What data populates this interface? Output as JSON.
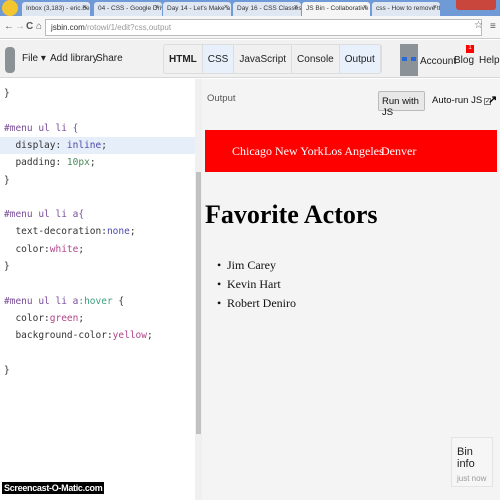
{
  "browser": {
    "tabs": [
      {
        "label": "Inbox (3,183) - eric.bemg",
        "active": false
      },
      {
        "label": "04 - CSS - Google Drive",
        "active": false
      },
      {
        "label": "Day 14 - Let's Make a Na",
        "active": false
      },
      {
        "label": "Day 16 - CSS Classes - Go",
        "active": false
      },
      {
        "label": "JS Bin - Collaborative Java",
        "active": true
      },
      {
        "label": "css - How to remove the",
        "active": false
      }
    ],
    "close_glyph": "×",
    "url_host": "jsbin.com",
    "url_path": "/rotowi/1/edit?css,output",
    "nav": {
      "back": "←",
      "forward": "→",
      "reload": "C",
      "home": "⌂",
      "star": "☆",
      "menu": "≡"
    }
  },
  "toolbar": {
    "file": "File ▾",
    "add_library": "Add library",
    "share": "Share",
    "panels": [
      {
        "label": "HTML",
        "active": false,
        "bold": true
      },
      {
        "label": "CSS",
        "active": true
      },
      {
        "label": "JavaScript",
        "active": false
      },
      {
        "label": "Console",
        "active": false
      },
      {
        "label": "Output",
        "active": true
      }
    ],
    "account": "Account",
    "blog": "Blog",
    "blog_badge": "1",
    "help": "Help"
  },
  "editor": {
    "lines": [
      [
        {
          "t": "}",
          "c": "prop"
        }
      ],
      [],
      [
        {
          "t": "#menu ul li {",
          "c": "sel"
        }
      ],
      [
        {
          "t": "  display: ",
          "c": "prop"
        },
        {
          "t": "inline",
          "c": "kw"
        },
        {
          "t": ";",
          "c": "prop"
        }
      ],
      [
        {
          "t": "  padding: ",
          "c": "prop"
        },
        {
          "t": "10px",
          "c": "num"
        },
        {
          "t": ";",
          "c": "prop"
        }
      ],
      [
        {
          "t": "}",
          "c": "prop"
        }
      ],
      [],
      [
        {
          "t": "#menu ul li a{",
          "c": "sel"
        }
      ],
      [
        {
          "t": "  text-decoration:",
          "c": "prop"
        },
        {
          "t": "none",
          "c": "kw"
        },
        {
          "t": ";",
          "c": "prop"
        }
      ],
      [
        {
          "t": "  color:",
          "c": "prop"
        },
        {
          "t": "white",
          "c": "col"
        },
        {
          "t": ";",
          "c": "prop"
        }
      ],
      [
        {
          "t": "}",
          "c": "prop"
        }
      ],
      [],
      [
        {
          "t": "#menu ul li a",
          "c": "sel"
        },
        {
          "t": ":hover",
          "c": "ps"
        },
        {
          "t": " {",
          "c": "prop"
        }
      ],
      [
        {
          "t": "  color:",
          "c": "prop"
        },
        {
          "t": "green",
          "c": "col"
        },
        {
          "t": ";",
          "c": "prop"
        }
      ],
      [
        {
          "t": "  background-color:",
          "c": "prop"
        },
        {
          "t": "yellow",
          "c": "col"
        },
        {
          "t": ";",
          "c": "prop"
        }
      ],
      [],
      [
        {
          "t": "}",
          "c": "prop"
        }
      ]
    ]
  },
  "output": {
    "label": "Output",
    "run_button": "Run with JS",
    "autorun_label": "Auto-run JS",
    "autorun_checked": true,
    "popout": "↗",
    "menu_links": [
      "Chicago",
      "New York",
      "Los Angeles",
      "Denver"
    ],
    "menu_bg": "#ff0000",
    "heading": "Favorite Actors",
    "list": [
      "Jim Carey",
      "Kevin Hart",
      "Robert Deniro"
    ]
  },
  "bin_info": {
    "title": "Bin info",
    "subtitle": "just now"
  },
  "watermark": "Screencast-O-Matic.com"
}
